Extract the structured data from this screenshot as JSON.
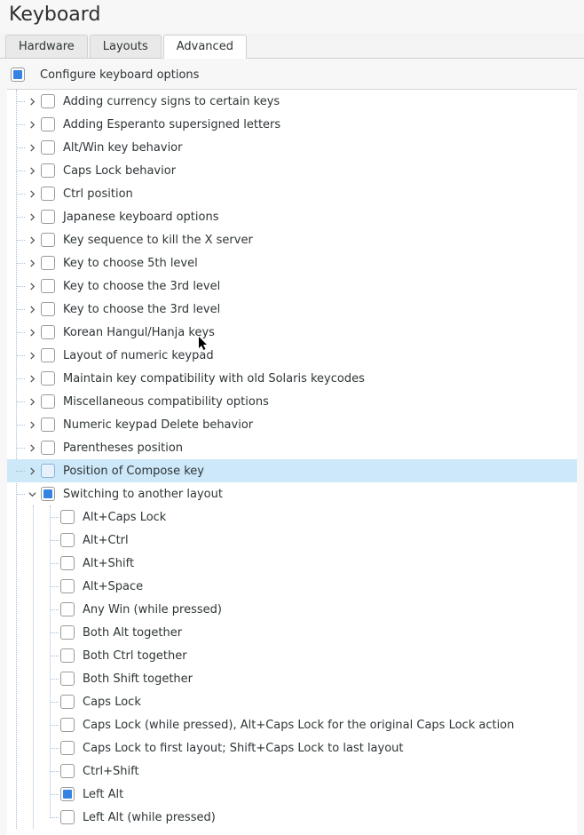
{
  "window": {
    "title": "Keyboard"
  },
  "tabs": [
    {
      "id": "hardware",
      "label": "Hardware",
      "active": false
    },
    {
      "id": "layouts",
      "label": "Layouts",
      "active": false
    },
    {
      "id": "advanced",
      "label": "Advanced",
      "active": true
    }
  ],
  "master": {
    "label": "Configure keyboard options",
    "state": "indeterminate"
  },
  "options": [
    {
      "label": "Adding currency signs to certain keys",
      "state": "unchecked",
      "expanded": false,
      "selected": false
    },
    {
      "label": "Adding Esperanto supersigned letters",
      "state": "unchecked",
      "expanded": false,
      "selected": false
    },
    {
      "label": "Alt/Win key behavior",
      "state": "unchecked",
      "expanded": false,
      "selected": false
    },
    {
      "label": "Caps Lock behavior",
      "state": "unchecked",
      "expanded": false,
      "selected": false
    },
    {
      "label": "Ctrl position",
      "state": "unchecked",
      "expanded": false,
      "selected": false
    },
    {
      "label": "Japanese keyboard options",
      "state": "unchecked",
      "expanded": false,
      "selected": false
    },
    {
      "label": "Key sequence to kill the X server",
      "state": "unchecked",
      "expanded": false,
      "selected": false
    },
    {
      "label": "Key to choose 5th level",
      "state": "unchecked",
      "expanded": false,
      "selected": false
    },
    {
      "label": "Key to choose the 3rd level",
      "state": "unchecked",
      "expanded": false,
      "selected": false
    },
    {
      "label": "Key to choose the 3rd level",
      "state": "unchecked",
      "expanded": false,
      "selected": false
    },
    {
      "label": "Korean Hangul/Hanja keys",
      "state": "unchecked",
      "expanded": false,
      "selected": false
    },
    {
      "label": "Layout of numeric keypad",
      "state": "unchecked",
      "expanded": false,
      "selected": false,
      "cursor": true
    },
    {
      "label": "Maintain key compatibility with old Solaris keycodes",
      "state": "unchecked",
      "expanded": false,
      "selected": false
    },
    {
      "label": "Miscellaneous compatibility options",
      "state": "unchecked",
      "expanded": false,
      "selected": false
    },
    {
      "label": "Numeric keypad Delete behavior",
      "state": "unchecked",
      "expanded": false,
      "selected": false
    },
    {
      "label": "Parentheses position",
      "state": "unchecked",
      "expanded": false,
      "selected": false
    },
    {
      "label": "Position of Compose key",
      "state": "unchecked",
      "expanded": false,
      "selected": true,
      "compose_style": true
    },
    {
      "label": "Switching to another layout",
      "state": "indeterminate",
      "expanded": true,
      "selected": false,
      "children": [
        {
          "label": "Alt+Caps Lock",
          "state": "unchecked"
        },
        {
          "label": "Alt+Ctrl",
          "state": "unchecked"
        },
        {
          "label": "Alt+Shift",
          "state": "unchecked"
        },
        {
          "label": "Alt+Space",
          "state": "unchecked"
        },
        {
          "label": "Any Win (while pressed)",
          "state": "unchecked"
        },
        {
          "label": "Both Alt together",
          "state": "unchecked"
        },
        {
          "label": "Both Ctrl together",
          "state": "unchecked"
        },
        {
          "label": "Both Shift together",
          "state": "unchecked"
        },
        {
          "label": "Caps Lock",
          "state": "unchecked"
        },
        {
          "label": "Caps Lock (while pressed), Alt+Caps Lock for the original Caps Lock action",
          "state": "unchecked"
        },
        {
          "label": "Caps Lock to first layout; Shift+Caps Lock to last layout",
          "state": "unchecked"
        },
        {
          "label": "Ctrl+Shift",
          "state": "unchecked"
        },
        {
          "label": "Left Alt",
          "state": "checked"
        },
        {
          "label": "Left Alt (while pressed)",
          "state": "unchecked"
        }
      ]
    }
  ]
}
